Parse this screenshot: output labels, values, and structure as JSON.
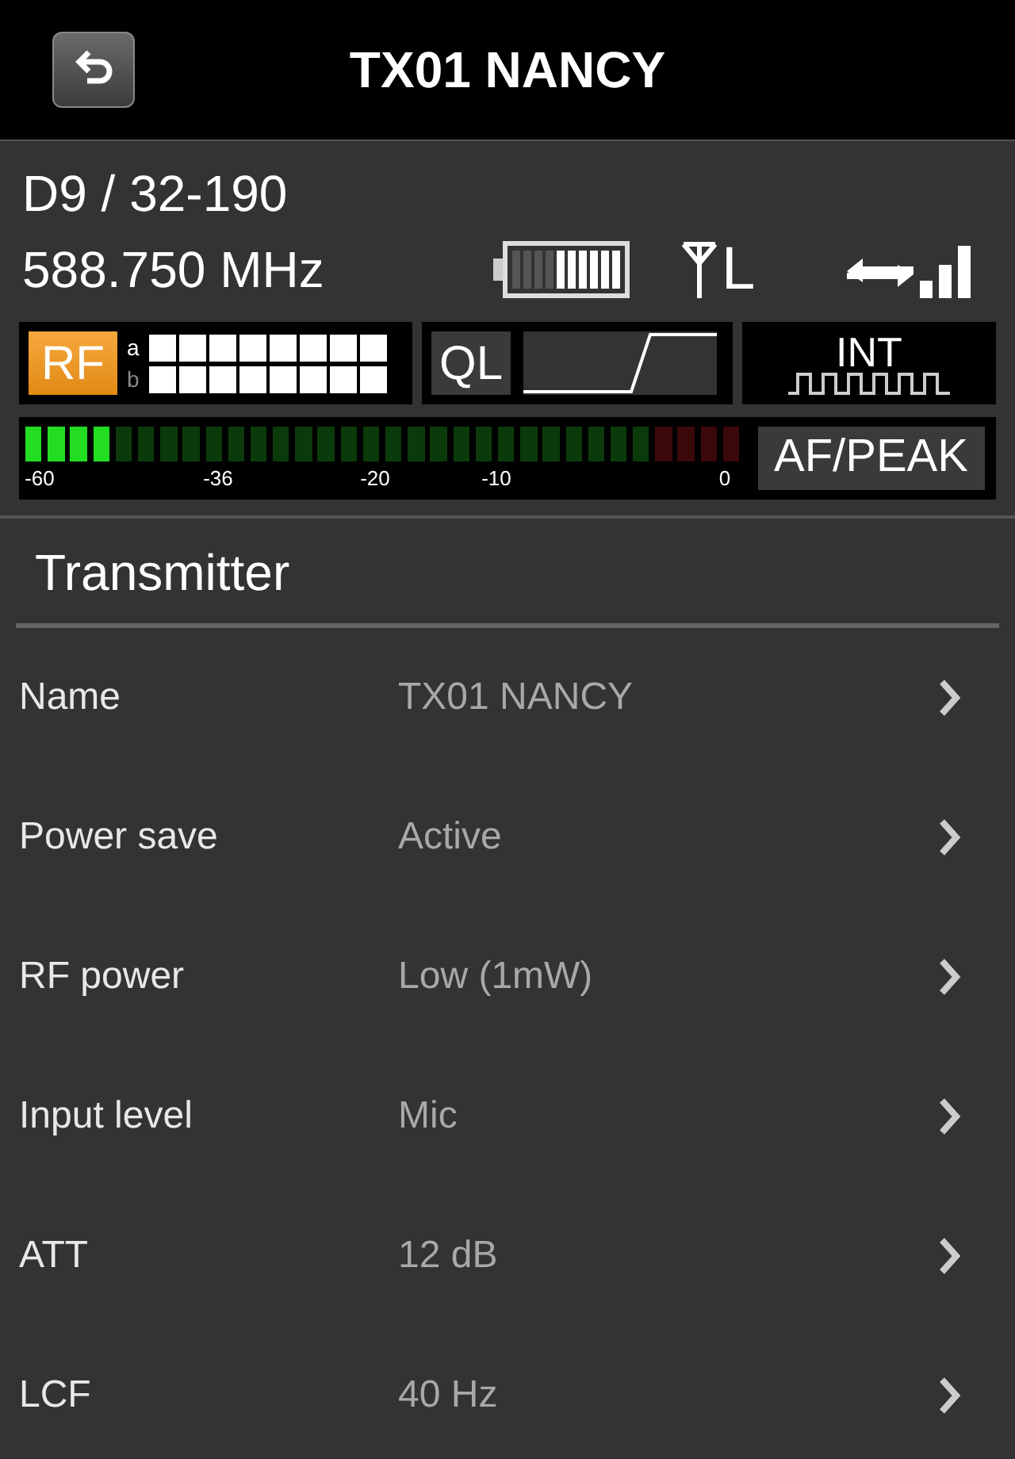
{
  "header": {
    "title": "TX01 NANCY"
  },
  "status": {
    "group_channel": "D9 / 32-190",
    "frequency": "588.750 MHz",
    "antenna": "L",
    "rf": {
      "label": "RF",
      "a": {
        "label": "a"
      },
      "b": {
        "label": "b"
      }
    },
    "ql": {
      "label": "QL"
    },
    "int": {
      "label": "INT"
    },
    "af_meter": {
      "level": 0.125,
      "ticks": [
        "-60",
        "-36",
        "-20",
        "-10",
        "0"
      ],
      "mode": "AF/PEAK"
    }
  },
  "section": {
    "title": "Transmitter"
  },
  "rows": [
    {
      "label": "Name",
      "value": "TX01 NANCY"
    },
    {
      "label": "Power save",
      "value": "Active"
    },
    {
      "label": "RF power",
      "value": "Low (1mW)"
    },
    {
      "label": "Input level",
      "value": "Mic"
    },
    {
      "label": "ATT",
      "value": "12 dB"
    },
    {
      "label": "LCF",
      "value": "40 Hz"
    }
  ]
}
